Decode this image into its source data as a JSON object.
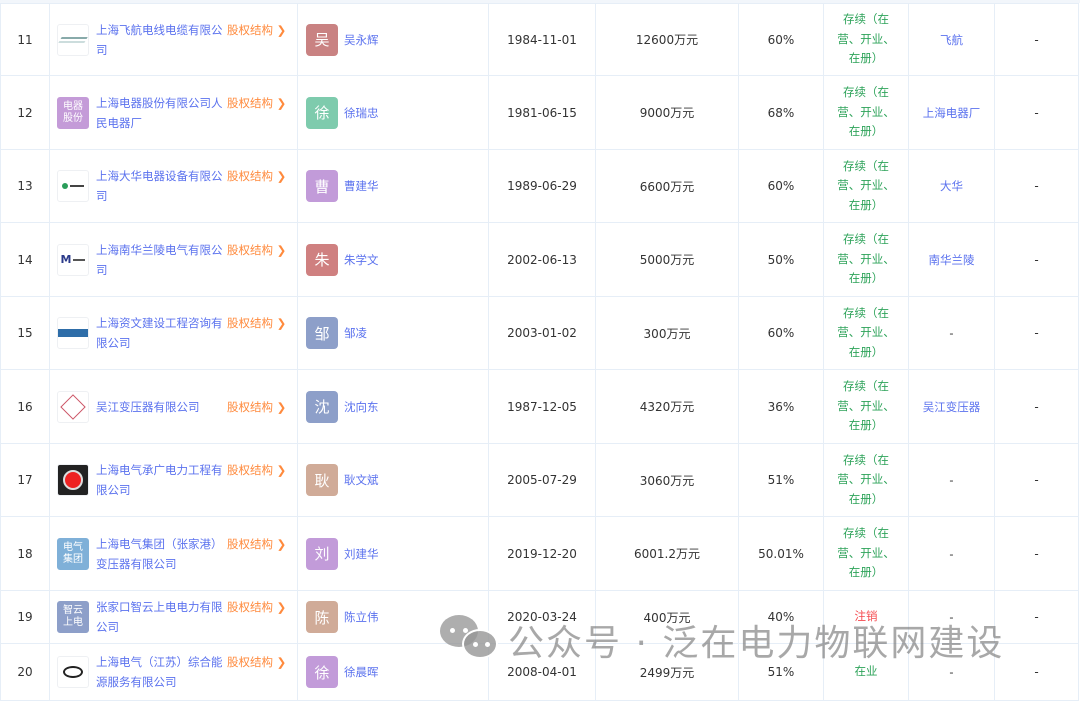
{
  "link_label": "股权结构",
  "rows": [
    {
      "no": "11",
      "company": "上海飞航电线电缆有限公司",
      "logo_text": "",
      "logo": "plane",
      "person": "吴永辉",
      "avatar": "吴",
      "avatar_color": "#c98282",
      "date": "1984-11-01",
      "capital": "12600万元",
      "ratio": "60%",
      "status": "存续（在营、开业、在册）",
      "status_color": "green",
      "group": "飞航",
      "extra": "-"
    },
    {
      "no": "12",
      "company": "上海电器股份有限公司人民电器厂",
      "logo_text": "电器股份",
      "logo": "text",
      "logo_color": "#c49bd8",
      "person": "徐瑞忠",
      "avatar": "徐",
      "avatar_color": "#7ecbad",
      "date": "1981-06-15",
      "capital": "9000万元",
      "ratio": "68%",
      "status": "存续（在营、开业、在册）",
      "status_color": "green",
      "group": "上海电器厂",
      "extra": "-"
    },
    {
      "no": "13",
      "company": "上海大华电器设备有限公司",
      "logo_text": "",
      "logo": "green",
      "person": "曹建华",
      "avatar": "曹",
      "avatar_color": "#c29bd9",
      "date": "1989-06-29",
      "capital": "6600万元",
      "ratio": "60%",
      "status": "存续（在营、开业、在册）",
      "status_color": "green",
      "group": "大华",
      "extra": "-"
    },
    {
      "no": "14",
      "company": "上海南华兰陵电气有限公司",
      "logo_text": "",
      "logo": "navy",
      "person": "朱学文",
      "avatar": "朱",
      "avatar_color": "#cf8080",
      "date": "2002-06-13",
      "capital": "5000万元",
      "ratio": "50%",
      "status": "存续（在营、开业、在册）",
      "status_color": "green",
      "group": "南华兰陵",
      "extra": "-"
    },
    {
      "no": "15",
      "company": "上海资文建设工程咨询有限公司",
      "logo_text": "",
      "logo": "blue",
      "person": "邹凌",
      "avatar": "邹",
      "avatar_color": "#8d9fc9",
      "date": "2003-01-02",
      "capital": "300万元",
      "ratio": "60%",
      "status": "存续（在营、开业、在册）",
      "status_color": "green",
      "group": "-",
      "extra": "-"
    },
    {
      "no": "16",
      "company": "吴江变压器有限公司",
      "logo_text": "",
      "logo": "ws",
      "person": "沈向东",
      "avatar": "沈",
      "avatar_color": "#8d9fc9",
      "date": "1987-12-05",
      "capital": "4320万元",
      "ratio": "36%",
      "status": "存续（在营、开业、在册）",
      "status_color": "green",
      "group": "吴江变压器",
      "extra": "-"
    },
    {
      "no": "17",
      "company": "上海电气承广电力工程有限公司",
      "logo_text": "",
      "logo": "c",
      "person": "耿文斌",
      "avatar": "耿",
      "avatar_color": "#d0ab98",
      "date": "2005-07-29",
      "capital": "3060万元",
      "ratio": "51%",
      "status": "存续（在营、开业、在册）",
      "status_color": "green",
      "group": "-",
      "extra": "-"
    },
    {
      "no": "18",
      "company": "上海电气集团（张家港）变压器有限公司",
      "logo_text": "电气集团",
      "logo": "text",
      "logo_color": "#7fb0d8",
      "person": "刘建华",
      "avatar": "刘",
      "avatar_color": "#c29bd9",
      "date": "2019-12-20",
      "capital": "6001.2万元",
      "ratio": "50.01%",
      "status": "存续（在营、开业、在册）",
      "status_color": "green",
      "group": "-",
      "extra": "-"
    },
    {
      "no": "19",
      "company": "张家口智云上电电力有限公司",
      "logo_text": "智云上电",
      "logo": "text",
      "logo_color": "#8d9fc9",
      "person": "陈立伟",
      "avatar": "陈",
      "avatar_color": "#d0ab98",
      "date": "2020-03-24",
      "capital": "400万元",
      "ratio": "40%",
      "status": "注销",
      "status_color": "red",
      "group": "-",
      "extra": "-"
    },
    {
      "no": "20",
      "company": "上海电气（江苏）综合能源服务有限公司",
      "logo_text": "",
      "logo": "swirl",
      "person": "徐晨晖",
      "avatar": "徐",
      "avatar_color": "#c29bd9",
      "date": "2008-04-01",
      "capital": "2499万元",
      "ratio": "51%",
      "status": "在业",
      "status_color": "green",
      "group": "-",
      "extra": "-"
    }
  ],
  "watermark": "公众号 · 泛在电力物联网建设"
}
